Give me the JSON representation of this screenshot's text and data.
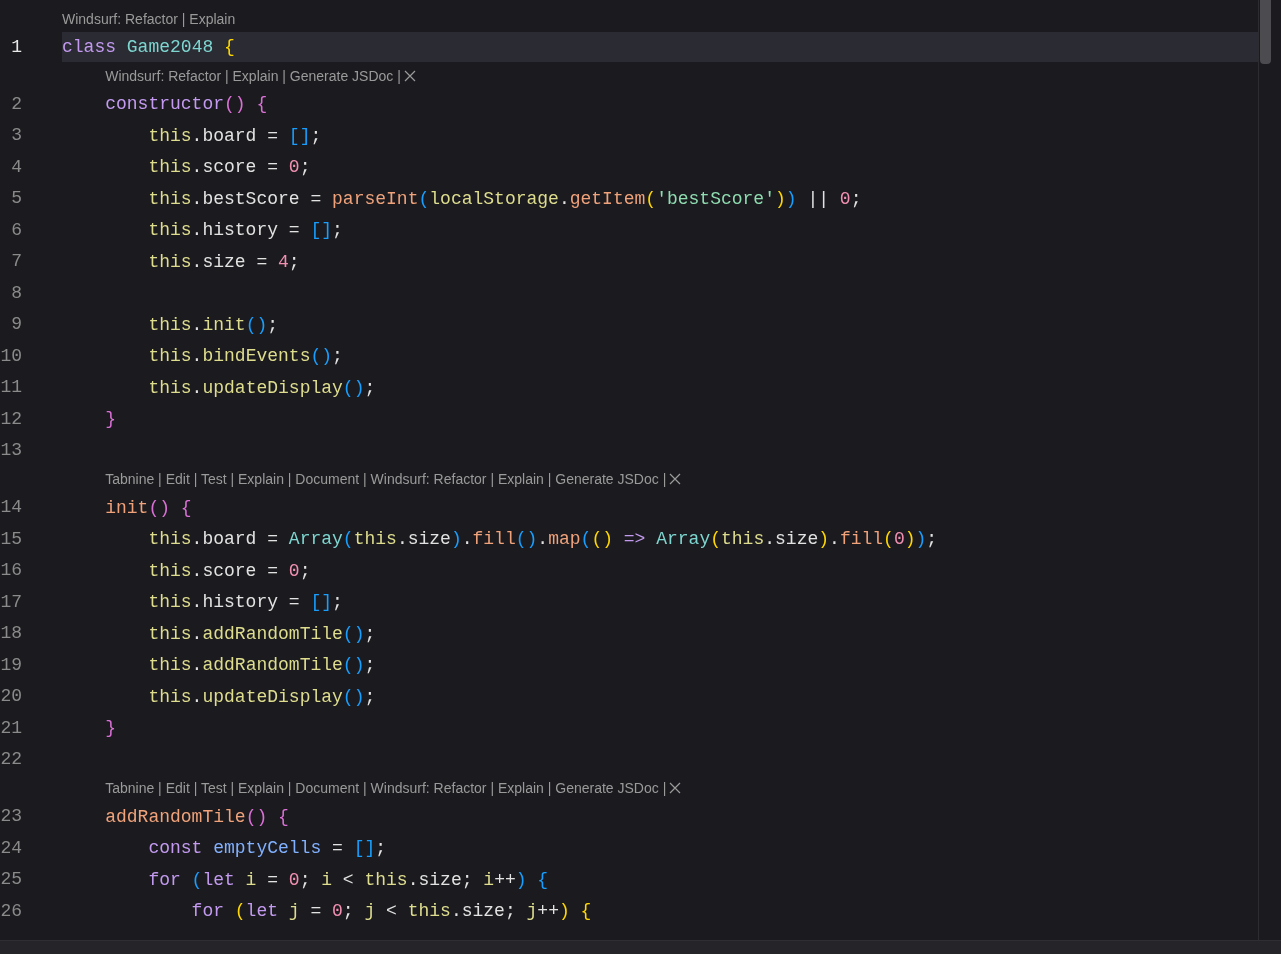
{
  "editor": {
    "rows": [
      {
        "kind": "lens",
        "text": "Windsurf: Refactor | Explain",
        "closable": false
      },
      {
        "kind": "code",
        "number": "1",
        "current": true,
        "tokens": [
          {
            "text": "class",
            "kind": "kw"
          },
          {
            "text": " Game2048",
            "kind": "cls"
          },
          {
            "text": " {",
            "kind": "br1"
          }
        ]
      },
      {
        "kind": "lens",
        "text": "Windsurf: Refactor | Explain | Generate JSDoc |",
        "closable": true
      },
      {
        "kind": "code",
        "number": "2",
        "current": false,
        "tokens": [
          {
            "text": "    constructor",
            "kind": "kw"
          },
          {
            "text": "()",
            "kind": "br2"
          },
          {
            "text": " {",
            "kind": "br2"
          }
        ]
      },
      {
        "kind": "code",
        "number": "3",
        "current": false,
        "tokens": [
          {
            "text": "        this",
            "kind": "this"
          },
          {
            "text": ".board = ",
            "kind": "op"
          },
          {
            "text": "[]",
            "kind": "br3"
          },
          {
            "text": ";",
            "kind": "op"
          }
        ]
      },
      {
        "kind": "code",
        "number": "4",
        "current": false,
        "tokens": [
          {
            "text": "        this",
            "kind": "this"
          },
          {
            "text": ".score = ",
            "kind": "op"
          },
          {
            "text": "0",
            "kind": "num"
          },
          {
            "text": ";",
            "kind": "op"
          }
        ]
      },
      {
        "kind": "code",
        "number": "5",
        "current": false,
        "tokens": [
          {
            "text": "        this",
            "kind": "this"
          },
          {
            "text": ".bestScore = ",
            "kind": "op"
          },
          {
            "text": "parseInt",
            "kind": "fn"
          },
          {
            "text": "(",
            "kind": "br3"
          },
          {
            "text": "localStorage",
            "kind": "var"
          },
          {
            "text": ".",
            "kind": "op"
          },
          {
            "text": "getItem",
            "kind": "fn"
          },
          {
            "text": "(",
            "kind": "br1"
          },
          {
            "text": "'bestScore'",
            "kind": "str"
          },
          {
            "text": ")",
            "kind": "br1"
          },
          {
            "text": ")",
            "kind": "br3"
          },
          {
            "text": " || ",
            "kind": "op"
          },
          {
            "text": "0",
            "kind": "num"
          },
          {
            "text": ";",
            "kind": "op"
          }
        ]
      },
      {
        "kind": "code",
        "number": "6",
        "current": false,
        "tokens": [
          {
            "text": "        this",
            "kind": "this"
          },
          {
            "text": ".history = ",
            "kind": "op"
          },
          {
            "text": "[]",
            "kind": "br3"
          },
          {
            "text": ";",
            "kind": "op"
          }
        ]
      },
      {
        "kind": "code",
        "number": "7",
        "current": false,
        "tokens": [
          {
            "text": "        this",
            "kind": "this"
          },
          {
            "text": ".size = ",
            "kind": "op"
          },
          {
            "text": "4",
            "kind": "num"
          },
          {
            "text": ";",
            "kind": "op"
          }
        ]
      },
      {
        "kind": "code",
        "number": "8",
        "current": false
      },
      {
        "kind": "code",
        "number": "9",
        "current": false,
        "tokens": [
          {
            "text": "        this",
            "kind": "this"
          },
          {
            "text": ".",
            "kind": "op"
          },
          {
            "text": "init",
            "kind": "this"
          },
          {
            "text": "()",
            "kind": "br3"
          },
          {
            "text": ";",
            "kind": "op"
          }
        ]
      },
      {
        "kind": "code",
        "number": "10",
        "current": false,
        "tokens": [
          {
            "text": "        this",
            "kind": "this"
          },
          {
            "text": ".",
            "kind": "op"
          },
          {
            "text": "bindEvents",
            "kind": "this"
          },
          {
            "text": "()",
            "kind": "br3"
          },
          {
            "text": ";",
            "kind": "op"
          }
        ]
      },
      {
        "kind": "code",
        "number": "11",
        "current": false,
        "tokens": [
          {
            "text": "        this",
            "kind": "this"
          },
          {
            "text": ".",
            "kind": "op"
          },
          {
            "text": "updateDisplay",
            "kind": "this"
          },
          {
            "text": "()",
            "kind": "br3"
          },
          {
            "text": ";",
            "kind": "op"
          }
        ]
      },
      {
        "kind": "code",
        "number": "12",
        "current": false,
        "tokens": [
          {
            "text": "    }",
            "kind": "br2"
          }
        ]
      },
      {
        "kind": "code",
        "number": "13",
        "current": false
      },
      {
        "kind": "lens",
        "text": "Tabnine | Edit | Test | Explain | Document | Windsurf: Refactor | Explain | Generate JSDoc |",
        "closable": true
      },
      {
        "kind": "code",
        "number": "14",
        "current": false,
        "tokens": [
          {
            "text": "    init",
            "kind": "fn"
          },
          {
            "text": "()",
            "kind": "br2"
          },
          {
            "text": " {",
            "kind": "br2"
          }
        ]
      },
      {
        "kind": "code",
        "number": "15",
        "current": false,
        "tokens": [
          {
            "text": "        this",
            "kind": "this"
          },
          {
            "text": ".board = ",
            "kind": "op"
          },
          {
            "text": "Array",
            "kind": "cls"
          },
          {
            "text": "(",
            "kind": "br3"
          },
          {
            "text": "this",
            "kind": "this"
          },
          {
            "text": ".size",
            "kind": "op"
          },
          {
            "text": ")",
            "kind": "br3"
          },
          {
            "text": ".",
            "kind": "op"
          },
          {
            "text": "fill",
            "kind": "fn"
          },
          {
            "text": "()",
            "kind": "br3"
          },
          {
            "text": ".",
            "kind": "op"
          },
          {
            "text": "map",
            "kind": "fn"
          },
          {
            "text": "(",
            "kind": "br3"
          },
          {
            "text": "()",
            "kind": "br1"
          },
          {
            "text": " =>",
            "kind": "kw"
          },
          {
            "text": " Array",
            "kind": "cls"
          },
          {
            "text": "(",
            "kind": "br1"
          },
          {
            "text": "this",
            "kind": "this"
          },
          {
            "text": ".size",
            "kind": "op"
          },
          {
            "text": ")",
            "kind": "br1"
          },
          {
            "text": ".",
            "kind": "op"
          },
          {
            "text": "fill",
            "kind": "fn"
          },
          {
            "text": "(",
            "kind": "br1"
          },
          {
            "text": "0",
            "kind": "num"
          },
          {
            "text": ")",
            "kind": "br1"
          },
          {
            "text": ")",
            "kind": "br3"
          },
          {
            "text": ";",
            "kind": "op"
          }
        ]
      },
      {
        "kind": "code",
        "number": "16",
        "current": false,
        "tokens": [
          {
            "text": "        this",
            "kind": "this"
          },
          {
            "text": ".score = ",
            "kind": "op"
          },
          {
            "text": "0",
            "kind": "num"
          },
          {
            "text": ";",
            "kind": "op"
          }
        ]
      },
      {
        "kind": "code",
        "number": "17",
        "current": false,
        "tokens": [
          {
            "text": "        this",
            "kind": "this"
          },
          {
            "text": ".history = ",
            "kind": "op"
          },
          {
            "text": "[]",
            "kind": "br3"
          },
          {
            "text": ";",
            "kind": "op"
          }
        ]
      },
      {
        "kind": "code",
        "number": "18",
        "current": false,
        "tokens": [
          {
            "text": "        this",
            "kind": "this"
          },
          {
            "text": ".",
            "kind": "op"
          },
          {
            "text": "addRandomTile",
            "kind": "this"
          },
          {
            "text": "()",
            "kind": "br3"
          },
          {
            "text": ";",
            "kind": "op"
          }
        ]
      },
      {
        "kind": "code",
        "number": "19",
        "current": false,
        "tokens": [
          {
            "text": "        this",
            "kind": "this"
          },
          {
            "text": ".",
            "kind": "op"
          },
          {
            "text": "addRandomTile",
            "kind": "this"
          },
          {
            "text": "()",
            "kind": "br3"
          },
          {
            "text": ";",
            "kind": "op"
          }
        ]
      },
      {
        "kind": "code",
        "number": "20",
        "current": false,
        "tokens": [
          {
            "text": "        this",
            "kind": "this"
          },
          {
            "text": ".",
            "kind": "op"
          },
          {
            "text": "updateDisplay",
            "kind": "this"
          },
          {
            "text": "()",
            "kind": "br3"
          },
          {
            "text": ";",
            "kind": "op"
          }
        ]
      },
      {
        "kind": "code",
        "number": "21",
        "current": false,
        "tokens": [
          {
            "text": "    }",
            "kind": "br2"
          }
        ]
      },
      {
        "kind": "code",
        "number": "22",
        "current": false
      },
      {
        "kind": "lens",
        "text": "Tabnine | Edit | Test | Explain | Document | Windsurf: Refactor | Explain | Generate JSDoc |",
        "closable": true
      },
      {
        "kind": "code",
        "number": "23",
        "current": false,
        "tokens": [
          {
            "text": "    addRandomTile",
            "kind": "fn"
          },
          {
            "text": "()",
            "kind": "br2"
          },
          {
            "text": " {",
            "kind": "br2"
          }
        ]
      },
      {
        "kind": "code",
        "number": "24",
        "current": false,
        "tokens": [
          {
            "text": "        const",
            "kind": "kw"
          },
          {
            "text": " emptyCells",
            "kind": "decl"
          },
          {
            "text": " = ",
            "kind": "op"
          },
          {
            "text": "[]",
            "kind": "br3"
          },
          {
            "text": ";",
            "kind": "op"
          }
        ]
      },
      {
        "kind": "code",
        "number": "25",
        "current": false,
        "tokens": [
          {
            "text": "        for",
            "kind": "kw"
          },
          {
            "text": " (",
            "kind": "br3"
          },
          {
            "text": "let",
            "kind": "kw"
          },
          {
            "text": " i",
            "kind": "var"
          },
          {
            "text": " = ",
            "kind": "op"
          },
          {
            "text": "0",
            "kind": "num"
          },
          {
            "text": "; ",
            "kind": "op"
          },
          {
            "text": "i",
            "kind": "var"
          },
          {
            "text": " < ",
            "kind": "op"
          },
          {
            "text": "this",
            "kind": "this"
          },
          {
            "text": ".size; ",
            "kind": "op"
          },
          {
            "text": "i",
            "kind": "var"
          },
          {
            "text": "++",
            "kind": "op"
          },
          {
            "text": ")",
            "kind": "br3"
          },
          {
            "text": " {",
            "kind": "br3"
          }
        ]
      },
      {
        "kind": "code",
        "number": "26",
        "current": false,
        "tokens": [
          {
            "text": "            for",
            "kind": "kw"
          },
          {
            "text": " (",
            "kind": "br1"
          },
          {
            "text": "let",
            "kind": "kw"
          },
          {
            "text": " j",
            "kind": "var"
          },
          {
            "text": " = ",
            "kind": "op"
          },
          {
            "text": "0",
            "kind": "num"
          },
          {
            "text": "; ",
            "kind": "op"
          },
          {
            "text": "j",
            "kind": "var"
          },
          {
            "text": " < ",
            "kind": "op"
          },
          {
            "text": "this",
            "kind": "this"
          },
          {
            "text": ".size; ",
            "kind": "op"
          },
          {
            "text": "j",
            "kind": "var"
          },
          {
            "text": "++",
            "kind": "op"
          },
          {
            "text": ")",
            "kind": "br1"
          },
          {
            "text": " {",
            "kind": "br1"
          }
        ]
      }
    ]
  }
}
